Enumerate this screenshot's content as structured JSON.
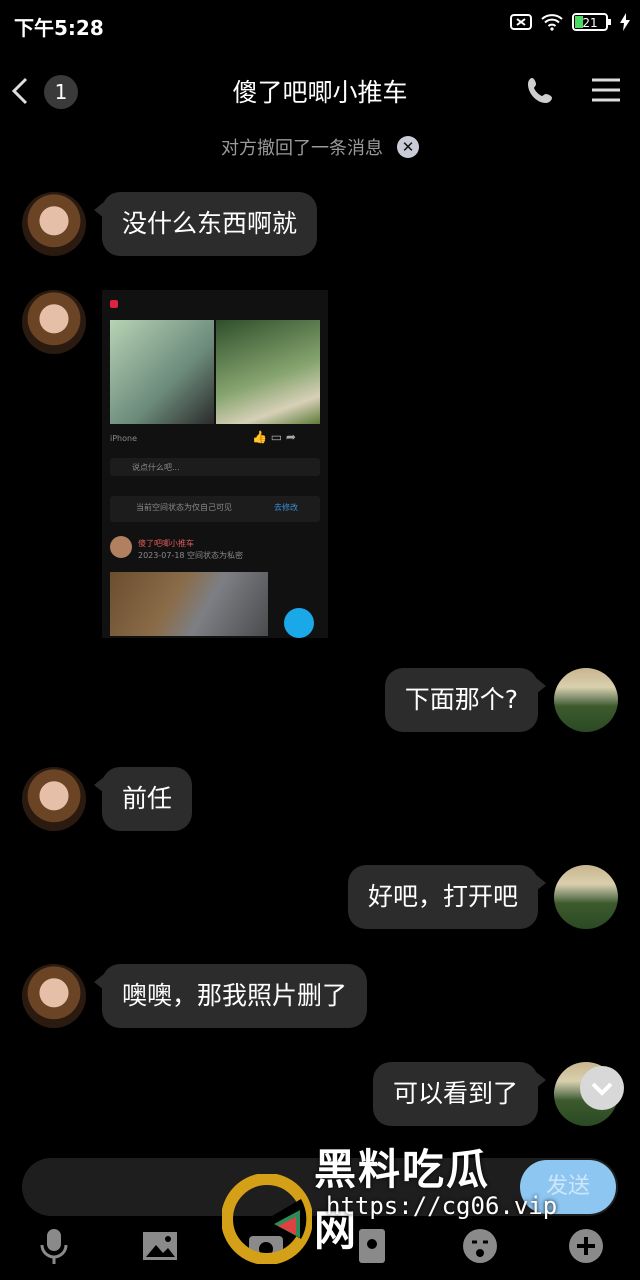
{
  "status_bar": {
    "time": "下午5:28",
    "battery": "21"
  },
  "header": {
    "unread_count": "1",
    "title": "傻了吧唧小推车"
  },
  "recall_notice": "对方撤回了一条消息",
  "messages": [
    {
      "side": "left",
      "text": "没什么东西啊就"
    },
    {
      "side": "left",
      "type": "image"
    },
    {
      "side": "right",
      "text": "下面那个?"
    },
    {
      "side": "left",
      "text": "前任"
    },
    {
      "side": "right",
      "text": "好吧，打开吧"
    },
    {
      "side": "left",
      "text": "噢噢，那我照片删了"
    },
    {
      "side": "right",
      "text": "可以看到了"
    }
  ],
  "shared_image": {
    "device": "iPhone",
    "comment_placeholder": "说点什么吧...",
    "privacy_note": "当前空间状态为仅自己可见",
    "privacy_action": "去修改",
    "post_user": "傻了吧唧小推车",
    "post_meta": "2023-07-18 空间状态为私密"
  },
  "composer": {
    "send_label": "发送"
  },
  "watermark": {
    "brand": "黑料吃瓜网",
    "url": "https://cg06.vip"
  },
  "colors": {
    "bubble": "#2c2c2c",
    "send": "#8ec6f2",
    "background": "#000000"
  }
}
